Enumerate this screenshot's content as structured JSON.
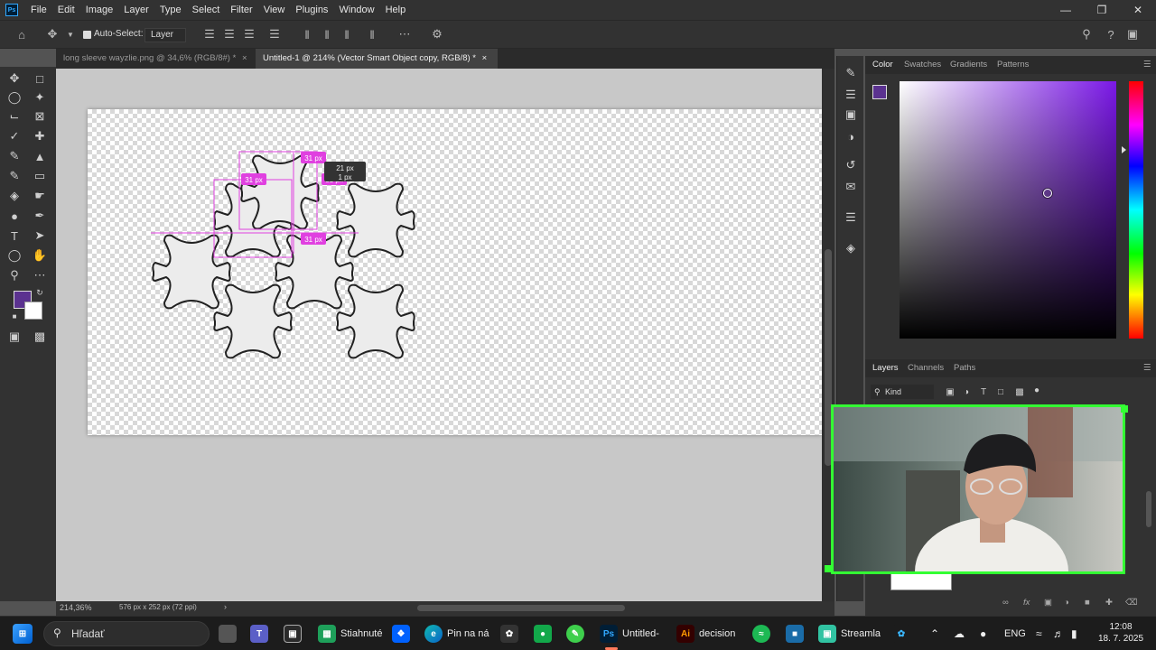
{
  "app": {
    "logo_text": "Ps"
  },
  "menu": [
    "File",
    "Edit",
    "Image",
    "Layer",
    "Type",
    "Select",
    "Filter",
    "View",
    "Plugins",
    "Window",
    "Help"
  ],
  "options_bar": {
    "auto_select_label": "Auto-Select:",
    "layer_select_value": "Layer"
  },
  "tabs": [
    {
      "label": "long sleeve wayzlie.png @ 34,6% (RGB/8#) *",
      "active": false
    },
    {
      "label": "Untitled-1 @ 214% (Vector Smart Object copy, RGB/8) *",
      "active": true
    }
  ],
  "canvas": {
    "measurements": [
      "31 px",
      "31 px",
      "31 px",
      "31 px"
    ],
    "tooltip_line1": "21 px",
    "tooltip_line2": "1 px"
  },
  "status": {
    "zoom": "214,36%",
    "doc_info": "576 px x 252 px (72 ppi)"
  },
  "color_panel": {
    "tabs": [
      "Color",
      "Swatches",
      "Gradients",
      "Patterns"
    ],
    "foreground": "#5b3290",
    "background": "#ffffff",
    "hue_color": "#7a18e6"
  },
  "layers_panel": {
    "tabs": [
      "Layers",
      "Channels",
      "Paths"
    ],
    "filter_kind": "Kind"
  },
  "taskbar": {
    "search_placeholder": "Hľadať",
    "apps": [
      "Stiahnuté",
      "Pin na ná",
      "Untitled-",
      "decision",
      "Streamla"
    ],
    "language": "ENG",
    "time": "12:08",
    "date": "18. 7. 2025"
  }
}
